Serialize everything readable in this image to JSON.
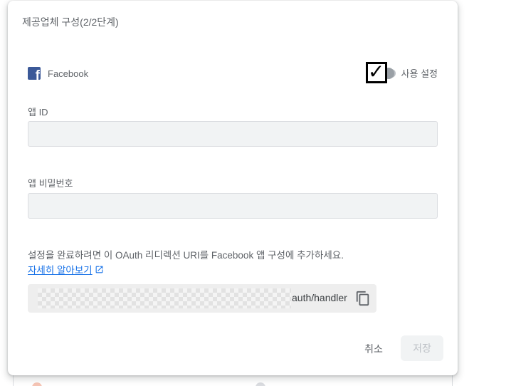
{
  "dialog": {
    "title": "제공업체 구성(2/2단계)",
    "provider": {
      "name": "Facebook",
      "icon": "facebook-icon",
      "brand_color": "#3b5998"
    },
    "toggle": {
      "label": "사용 설정",
      "checked": true
    },
    "fields": {
      "app_id_label": "앱 ID",
      "app_id_value": "",
      "app_secret_label": "앱 비밀번호",
      "app_secret_value": ""
    },
    "instruction": "설정을 완료하려면 이 OAuth 리디렉션 URI를 Facebook 앱 구성에 추가하세요.",
    "learn_more": "자세히 알아보기",
    "redirect_uri_suffix": "auth/handler",
    "buttons": {
      "cancel": "취소",
      "save": "저장"
    }
  },
  "colors": {
    "link": "#1a73e8",
    "input_bg": "#f1f3f4",
    "text": "#5f6368"
  }
}
